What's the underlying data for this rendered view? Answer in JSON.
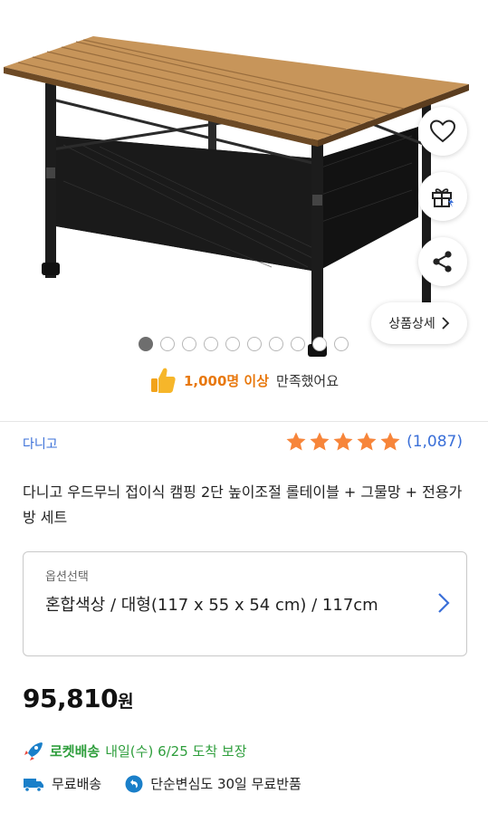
{
  "product_image": {
    "carousel_total": 10,
    "carousel_active_index": 0
  },
  "side_actions": {
    "wishlist_icon": "heart-icon",
    "gift_icon": "gift-icon",
    "share_icon": "share-icon"
  },
  "detail_button": {
    "label": "상품상세"
  },
  "satisfaction": {
    "highlight": "1,000명 이상",
    "rest": "만족했어요"
  },
  "brand": {
    "name": "다니고"
  },
  "rating": {
    "stars": 5,
    "count": "(1,087)",
    "star_color": "#f7853a"
  },
  "product": {
    "title": "다니고 우드무늬 접이식 캠핑 2단 높이조절 롤테이블 + 그물망 + 전용가방 세트"
  },
  "option": {
    "label": "옵션선택",
    "value": "혼합색상 / 대형(117 x 55 x 54 cm) / 117cm"
  },
  "price": {
    "amount": "95,810",
    "currency": "원"
  },
  "delivery": {
    "rocket_label": "로켓배송",
    "eta": "내일(수) 6/25 도착 보장",
    "free_shipping": "무료배송",
    "return_policy": "단순변심도 30일 무료반품"
  },
  "colors": {
    "accent_blue": "#3a6fd8",
    "rocket_green": "#2e9e3c",
    "satisfaction_orange": "#e8780d"
  }
}
